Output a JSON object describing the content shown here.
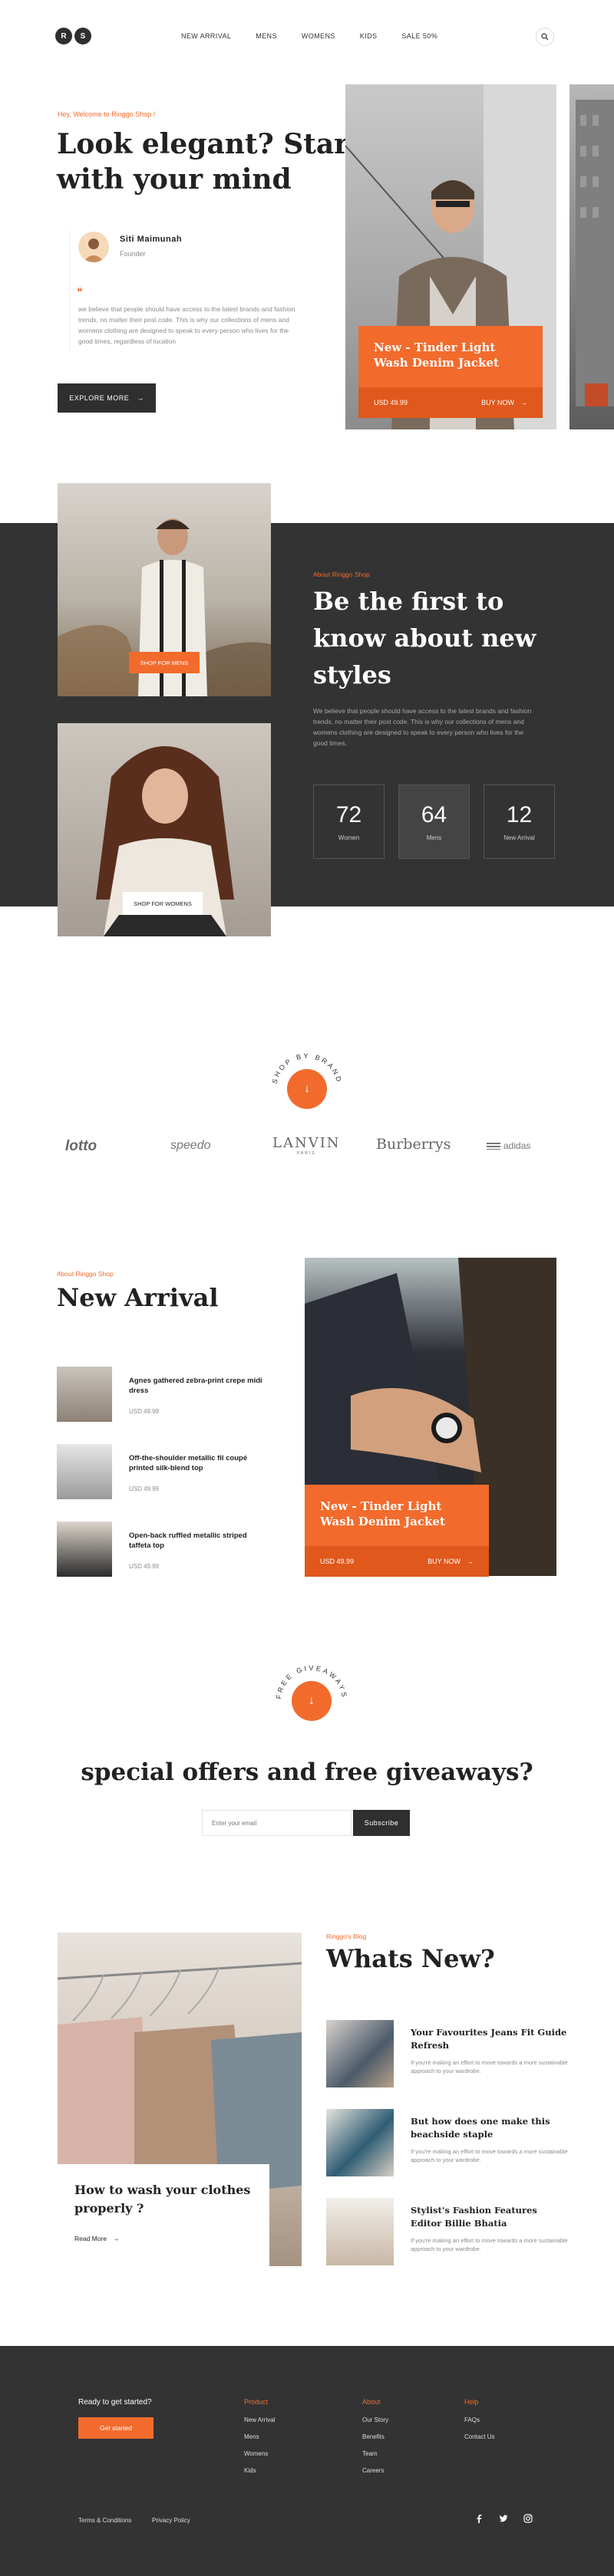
{
  "header": {
    "logo_letters": [
      "R",
      "S"
    ],
    "nav": [
      "NEW ARRIVAL",
      "MENS",
      "WOMENS",
      "KIDS",
      "SALE 50%"
    ],
    "search_icon": "search-icon"
  },
  "hero": {
    "eyebrow": "Hey, Welcome to Ringgo Shop !",
    "title_line1": "Look elegant? Start",
    "title_line2": "with your mind",
    "author_name": "Siti Maimunah",
    "author_role": "Founder",
    "quote_mark": "❝",
    "quote_text": "we believe that people should have access to the latest brands and fashion trends, no matter their post code. This is why our collections of mens and womens clothing are designed to speak to every person who lives for the good times, regardless of location",
    "cta": "EXPLORE MORE",
    "card_title": "New - Tinder Light Wash Denim Jacket",
    "card_price": "USD 49.99",
    "card_buy": "BUY NOW"
  },
  "about": {
    "eyebrow": "About Ringgo Shop",
    "title_line1": "Be the first to",
    "title_line2": "know about new",
    "title_line3": "styles",
    "text": "We believe that people should have access to the latest brands and fashion trends, no matter their post code. This is why our collections of mens and womens clothing are designed to speak to every person who lives for the good times.",
    "shop_men": "SHOP FOR MENS",
    "shop_women": "SHOP FOR WOMENS",
    "stats": [
      {
        "num": "72",
        "label": "Women"
      },
      {
        "num": "64",
        "label": "Mens"
      },
      {
        "num": "12",
        "label": "New Arrival"
      }
    ]
  },
  "brands": {
    "badge_text": "SHOP BY BRAND",
    "items": [
      "lotto",
      "speedo",
      "LANVIN",
      "Burberrys",
      "adidas"
    ],
    "lanvin_sub": "PARIS",
    "brand_colors": {
      "accent": "#f26b2c",
      "dark": "#2f2f2f"
    }
  },
  "arrival": {
    "eyebrow": "About Ringgo Shop",
    "title": "New Arrival",
    "items": [
      {
        "name": "Agnes gathered zebra-print crepe midi dress",
        "price": "USD 49.99"
      },
      {
        "name": "Off-the-shoulder metallic fil coupé printed silk-blend top",
        "price": "USD 49.99"
      },
      {
        "name": "Open-back ruffled metallic striped taffeta top",
        "price": "USD 49.99"
      }
    ],
    "card_title": "New - Tinder Light Wash Denim Jacket",
    "card_price": "USD 49.99",
    "card_buy": "BUY NOW"
  },
  "giveaway": {
    "badge_text": "FREE GIVEAWAYS",
    "title": "special offers and free giveaways?",
    "email_placeholder": "Enter your email",
    "subscribe": "Subscribe"
  },
  "blog": {
    "feature_title": "How to wash your clothes properly ?",
    "read_more": "Read More",
    "eyebrow": "Ringgo's Blog",
    "title": "Whats New?",
    "posts": [
      {
        "title": "Your Favourites Jeans Fit Guide Refresh",
        "text": "If you're making an effort to move towards a more sustainable approach to your wardrobe."
      },
      {
        "title": "But how does one make this beachside staple",
        "text": "If you're making an effort to move towards a more sustainable approach to your wardrobe."
      },
      {
        "title": "Stylist's Fashion Features Editor Billie Bhatia",
        "text": "If you're making an effort to move towards a more sustainable approach to your wardrobe."
      }
    ]
  },
  "footer": {
    "ready": "Ready to get started?",
    "get_started": "Get started",
    "cols": [
      {
        "title": "Product",
        "items": [
          "New Arrival",
          "Mens",
          "Womens",
          "Kids"
        ]
      },
      {
        "title": "About",
        "items": [
          "Our Story",
          "Benefits",
          "Team",
          "Careers"
        ]
      },
      {
        "title": "Help",
        "items": [
          "FAQs",
          "Contact Us"
        ]
      }
    ],
    "terms": "Terms & Conditions",
    "privacy": "Privacy Policy",
    "social": [
      "facebook-icon",
      "twitter-icon",
      "instagram-icon"
    ]
  }
}
